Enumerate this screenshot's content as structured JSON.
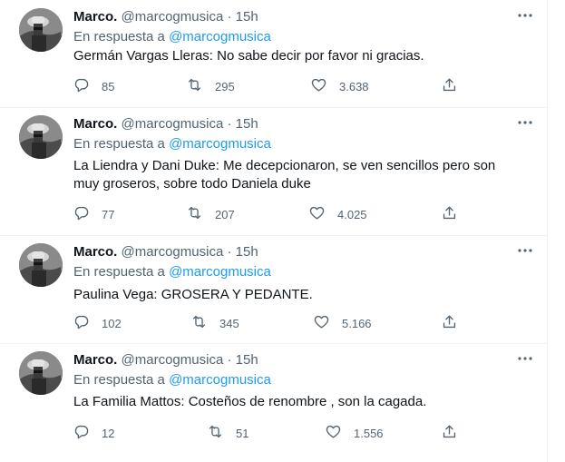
{
  "tweets": [
    {
      "name": "Marco.",
      "handle": "@marcogmusica",
      "separator": "·",
      "time": "15h",
      "reply_prefix": "En respuesta a",
      "reply_to": "@marcogmusica",
      "text": "Germán Vargas Lleras: No sabe decir por favor ni gracias.",
      "replies": "85",
      "retweets": "295",
      "likes": "3.638"
    },
    {
      "name": "Marco.",
      "handle": "@marcogmusica",
      "separator": "·",
      "time": "15h",
      "reply_prefix": "En respuesta a",
      "reply_to": "@marcogmusica",
      "text": "La Liendra y Dani Duke: Me decepcionaron, se ven sencillos pero son muy groseros, sobre todo Daniela duke",
      "replies": "77",
      "retweets": "207",
      "likes": "4.025"
    },
    {
      "name": "Marco.",
      "handle": "@marcogmusica",
      "separator": "·",
      "time": "15h",
      "reply_prefix": "En respuesta a",
      "reply_to": "@marcogmusica",
      "text": "Paulina Vega: GROSERA Y PEDANTE.",
      "replies": "102",
      "retweets": "345",
      "likes": "5.166"
    },
    {
      "name": "Marco.",
      "handle": "@marcogmusica",
      "separator": "·",
      "time": "15h",
      "reply_prefix": "En respuesta a",
      "reply_to": "@marcogmusica",
      "text": "La Familia Mattos: Costeños de renombre , son la cagada.",
      "replies": "12",
      "retweets": "51",
      "likes": "1.556"
    }
  ],
  "icons": {
    "reply": "reply-icon",
    "retweet": "retweet-icon",
    "like": "heart-icon",
    "share": "share-icon",
    "more": "more-icon"
  },
  "colors": {
    "link": "#1d9bf0",
    "secondary_text": "#536471",
    "primary_text": "#0f1419",
    "divider": "#eff3f4"
  }
}
